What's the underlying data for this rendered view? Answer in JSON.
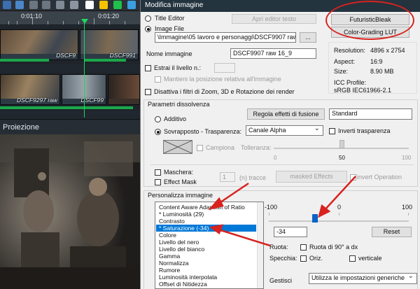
{
  "timeline": {
    "time_marks": [
      "0:01:10",
      "0:01:20"
    ],
    "clips": [
      {
        "label": "DSCF9"
      },
      {
        "label": "DSCF991"
      },
      {
        "label": "DSCF9297 raw"
      },
      {
        "label": "DSCF99"
      }
    ],
    "section_title": "Proiezione"
  },
  "dialog": {
    "title": "Modifica immagine",
    "title_editor_label": "Title Editor",
    "open_title_editor": "Apri editor testo",
    "image_file_label": "Image File",
    "image_path": "\\Immagine\\05 lavoro e personaggi\\DSCF9907 raw 16_",
    "browse_label": "...",
    "image_name_label": "Nome immagine",
    "image_name_value": "DSCF9907 raw 16_9",
    "extract_level_label": "Estrai il livello n.:",
    "keep_position_label": "Mantieni la posizione relativa all'immagine",
    "disable_filters_label": "Disattiva i filtri di Zoom, 3D e Rotazione dei render",
    "lut_buttons": [
      "FuturisticBleak",
      "Color-Grading LUT"
    ],
    "info": {
      "resolution_label": "Resolution:",
      "resolution_value": "4896 x 2754",
      "aspect_label": "Aspect:",
      "aspect_value": "16:9",
      "size_label": "Size:",
      "size_value": "8.90 MB",
      "icc_label": "ICC Profile:",
      "icc_value": "sRGB IEC61966-2.1"
    },
    "blend": {
      "group_title": "Parametri dissolvenza",
      "additive_label": "Additivo",
      "overlay_label": "Sovrapposto - Trasparenza:",
      "blend_effects_button": "Regola effetti di fusione",
      "standard_value": "Standard",
      "channel_value": "Canale Alpha",
      "invert_transparency_label": "Inverti trasparenza",
      "sample_label": "Campiona",
      "tolerance_label": "Tolleranza:",
      "tolerance_value": 50,
      "tolerance_ticks": [
        "0",
        "50",
        "100"
      ],
      "mask_label": "Maschera:",
      "effect_mask_label": "Effect Mask",
      "tracks_value": "1",
      "tracks_label": "(n) tracce",
      "masked_effects_button": "masked Effects",
      "invert_operation_label": "invert Operation"
    },
    "customize": {
      "group_title": "Personalizza immagine",
      "items": [
        "Content Aware Adaption of Ratio",
        "* Luminosità (29)",
        "Contrasto",
        "* Saturazione (-34)",
        "Colore",
        "Livello del nero",
        "Livello del bianco",
        "Gamma",
        "Normalizza",
        "Rumore",
        "Luminosità interpolata",
        "Offset di Nitidezza"
      ],
      "selected_index": 3,
      "slider_ticks": [
        "-100",
        "0",
        "100"
      ],
      "slider_value": -34,
      "value_field": "-34",
      "reset_button": "Reset",
      "rotate_label": "Ruota:",
      "rotate_90_label": "Ruota di 90° a dx",
      "mirror_label": "Specchia:",
      "horizontal_label": "Oriz.",
      "vertical_label": "verticale",
      "manage_label": "Gestisci",
      "manage_value": "Utilizza le impostazioni generiche"
    }
  },
  "colors": {
    "annotation": "#d8221e",
    "selection": "#0078d7",
    "timeline_bar": "#1aa84a",
    "slider_thumb": "#0a64c8"
  }
}
